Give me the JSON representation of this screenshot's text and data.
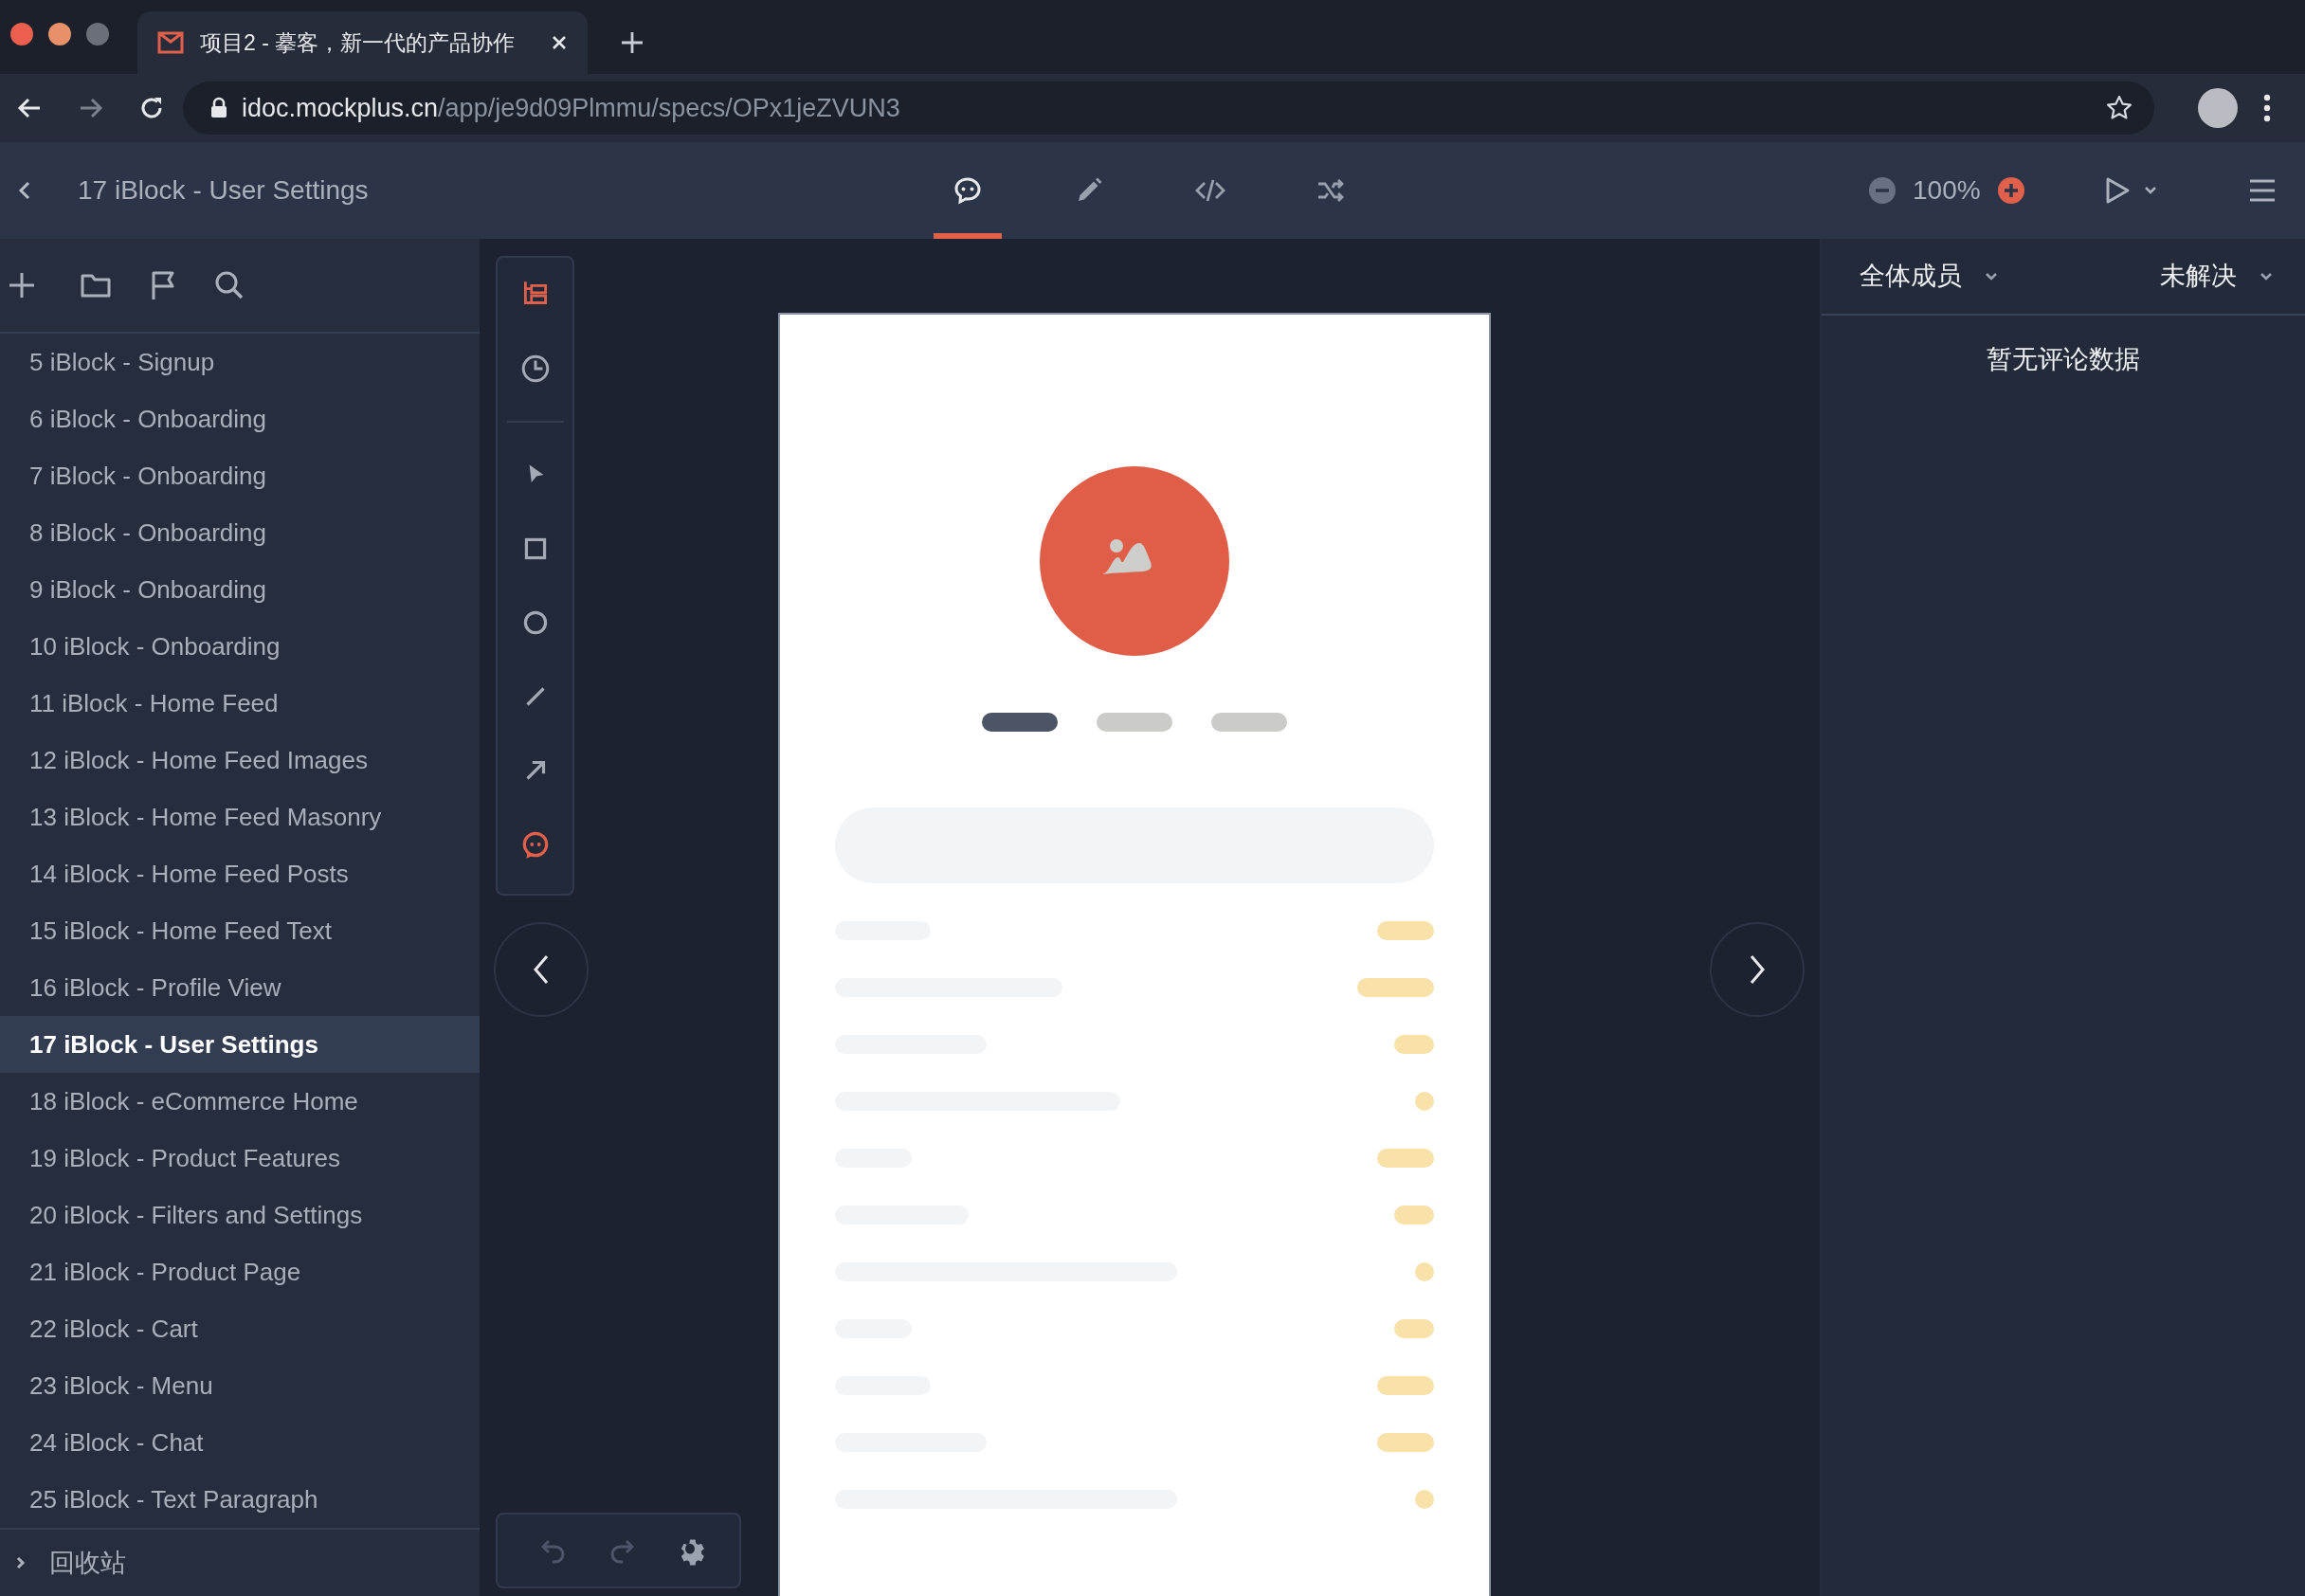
{
  "browser": {
    "tab": {
      "title": "项目2 - 摹客，新一代的产品协作"
    },
    "url": {
      "host": "idoc.mockplus.cn",
      "path": "/app/je9d09Plmmu/specs/OPx1jeZVUN3"
    }
  },
  "header": {
    "title": "17 iBlock - User Settings",
    "modes": [
      {
        "kind": "comment",
        "selected": true
      },
      {
        "kind": "edit",
        "selected": false
      },
      {
        "kind": "code",
        "selected": false
      },
      {
        "kind": "flow",
        "selected": false
      }
    ],
    "zoom": "100%"
  },
  "sidebar": {
    "pages": [
      {
        "label": "5 iBlock - Signup",
        "selected": false
      },
      {
        "label": "6 iBlock - Onboarding",
        "selected": false
      },
      {
        "label": "7 iBlock - Onboarding",
        "selected": false
      },
      {
        "label": "8 iBlock - Onboarding",
        "selected": false
      },
      {
        "label": "9 iBlock - Onboarding",
        "selected": false
      },
      {
        "label": "10 iBlock - Onboarding",
        "selected": false
      },
      {
        "label": "11 iBlock - Home Feed",
        "selected": false
      },
      {
        "label": "12 iBlock - Home Feed Images",
        "selected": false
      },
      {
        "label": "13 iBlock - Home Feed Masonry",
        "selected": false
      },
      {
        "label": "14 iBlock - Home Feed Posts",
        "selected": false
      },
      {
        "label": "15 iBlock - Home Feed Text",
        "selected": false
      },
      {
        "label": "16 iBlock - Profile View",
        "selected": false
      },
      {
        "label": "17 iBlock - User Settings",
        "selected": true
      },
      {
        "label": "18 iBlock - eCommerce Home",
        "selected": false
      },
      {
        "label": "19 iBlock - Product Features",
        "selected": false
      },
      {
        "label": "20 iBlock - Filters and Settings",
        "selected": false
      },
      {
        "label": "21 iBlock - Product Page",
        "selected": false
      },
      {
        "label": "22 iBlock - Cart",
        "selected": false
      },
      {
        "label": "23 iBlock - Menu",
        "selected": false
      },
      {
        "label": "24 iBlock - Chat",
        "selected": false
      },
      {
        "label": "25 iBlock - Text Paragraph",
        "selected": false
      }
    ],
    "trash": {
      "label": "回收站",
      "expanded": false
    }
  },
  "tools": [
    {
      "kind": "layers",
      "active": true
    },
    {
      "kind": "history",
      "active": false
    },
    {
      "kind": "pointer",
      "active": false
    },
    {
      "kind": "rectangle",
      "active": false
    },
    {
      "kind": "ellipse",
      "active": false
    },
    {
      "kind": "line",
      "active": false
    },
    {
      "kind": "arrow",
      "active": false
    },
    {
      "kind": "comment",
      "active": true
    }
  ],
  "preview": {
    "indicators": [
      {
        "selected": true
      },
      {
        "selected": false
      },
      {
        "selected": false
      }
    ]
  },
  "comments": {
    "member_filter": "全体成员",
    "status_filter": "未解决",
    "empty_text": "暂无评论数据"
  }
}
